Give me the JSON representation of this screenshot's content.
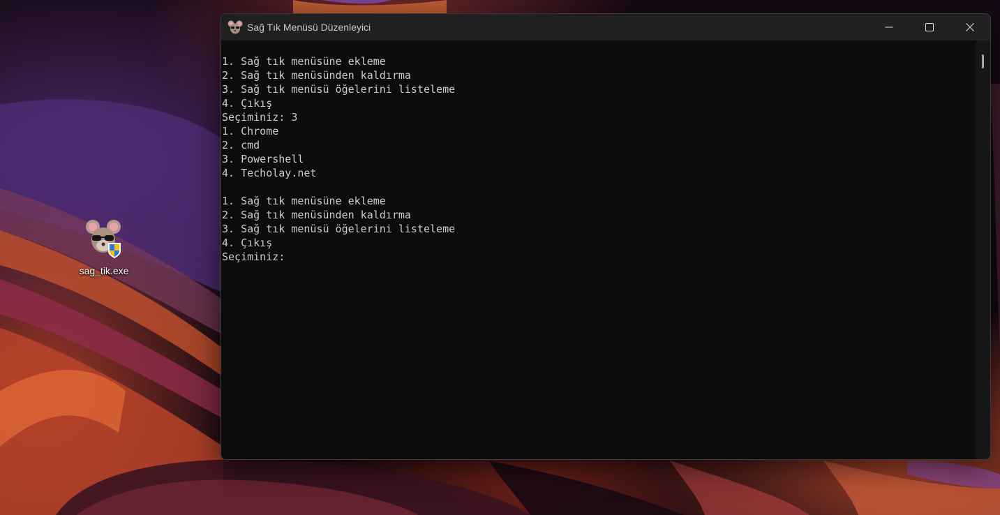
{
  "desktop": {
    "icon": {
      "label": "sag_tik.exe",
      "icon_name": "mouse-with-sunglasses-and-uac-shield-icon"
    }
  },
  "window": {
    "title": "Sağ Tık Menüsü Düzenleyici",
    "app_icon": "mouse-mascot-icon",
    "controls": {
      "minimize": "minimize-icon",
      "maximize": "maximize-icon",
      "close": "close-icon"
    }
  },
  "console": {
    "background": "#0c0c0c",
    "foreground": "#cccccc",
    "lines": [
      "1. Sağ tık menüsüne ekleme",
      "2. Sağ tık menüsünden kaldırma",
      "3. Sağ tık menüsü öğelerini listeleme",
      "4. Çıkış",
      "Seçiminiz: 3",
      "1. Chrome",
      "2. cmd",
      "3. Powershell",
      "4. Techolay.net",
      "",
      "1. Sağ tık menüsüne ekleme",
      "2. Sağ tık menüsünden kaldırma",
      "3. Sağ tık menüsü öğelerini listeleme",
      "4. Çıkış",
      "Seçiminiz:"
    ]
  }
}
